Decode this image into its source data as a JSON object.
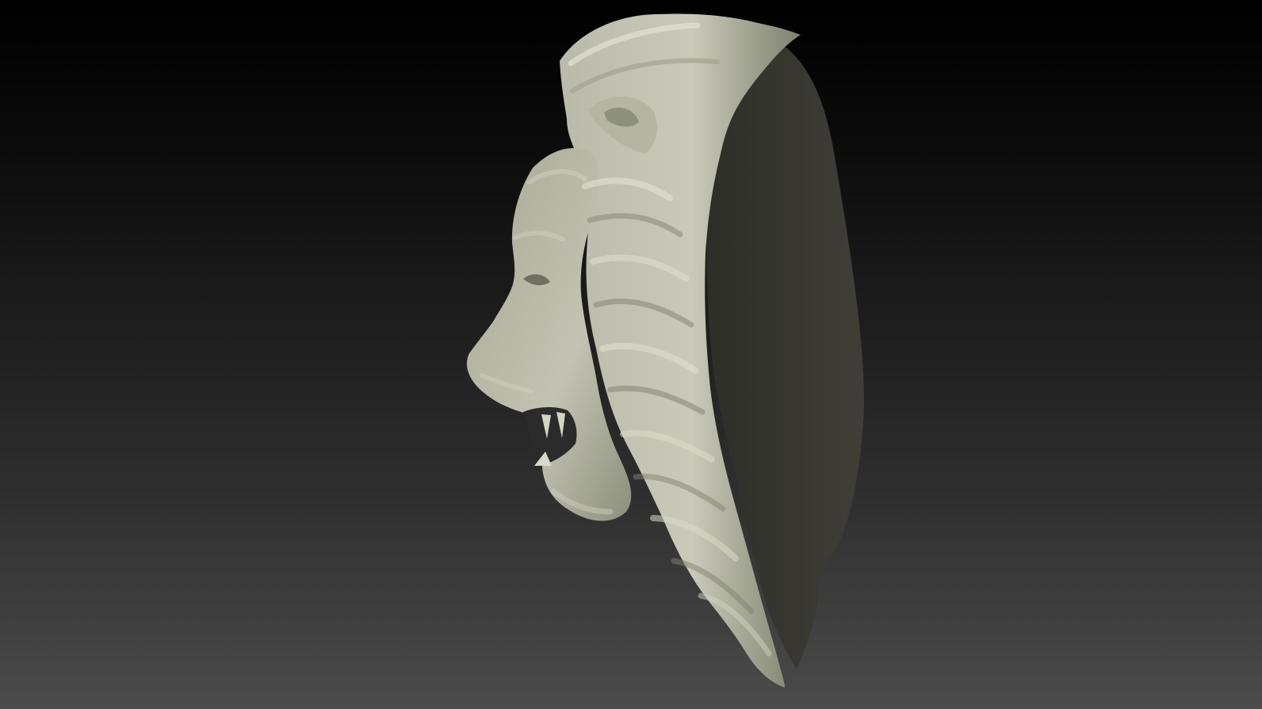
{
  "canvas": {
    "background_top": "#000000",
    "background_bottom": "#4b4b4b"
  },
  "model": {
    "subject": "lion-head-relief",
    "surface_color": "#c5c6b6",
    "surface_shadow": "#7e806f",
    "backplate_color": "#3a3a33"
  }
}
